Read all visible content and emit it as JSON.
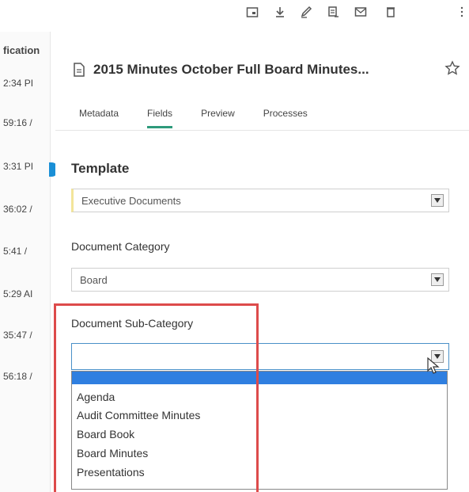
{
  "toolbar": {
    "icons": [
      "add-note-icon",
      "download-icon",
      "sign-icon",
      "document-icon",
      "mail-icon",
      "trash-icon",
      "more-icon"
    ]
  },
  "left_list": {
    "header": "fication",
    "rows": [
      "2:34 PI",
      "59:16 /",
      "3:31 PI",
      "36:02 /",
      "5:41 /",
      "5:29 AI",
      "35:47 /",
      "56:18 /"
    ]
  },
  "document": {
    "title": "2015 Minutes October Full Board Minutes..."
  },
  "tabs": [
    {
      "label": "Metadata",
      "active": false
    },
    {
      "label": "Fields",
      "active": true
    },
    {
      "label": "Preview",
      "active": false
    },
    {
      "label": "Processes",
      "active": false
    }
  ],
  "form": {
    "section_title": "Template",
    "template_value": "Executive Documents",
    "category_label": "Document Category",
    "category_value": "Board",
    "subcategory_label": "Document Sub-Category",
    "subcategory_value": ""
  },
  "dropdown": {
    "options": [
      "",
      "Agenda",
      "Audit Committee Minutes",
      "Board Book",
      "Board Minutes",
      "Presentations"
    ],
    "highlighted_index": 0
  },
  "colors": {
    "accent": "#2e9a7b",
    "highlight": "#2f7fe0",
    "annotation": "#dd4b4b",
    "marker": "#1a8fd6"
  }
}
